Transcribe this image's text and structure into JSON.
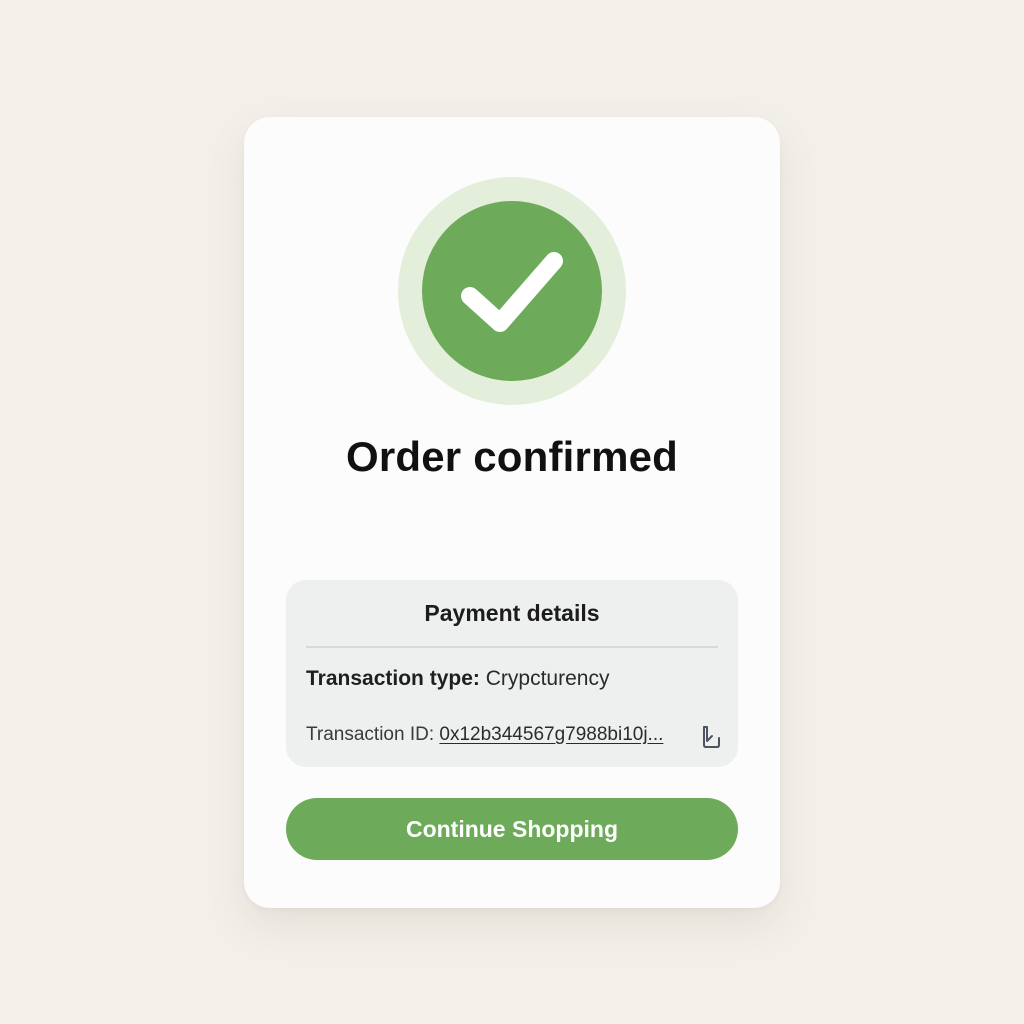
{
  "confirmation": {
    "icon": "checkmark-icon",
    "title": "Order confirmed"
  },
  "payment": {
    "heading": "Payment details",
    "type_label": "Transaction type:",
    "type_value": "Crypcturency",
    "id_label": "Transaction ID:",
    "id_value": "0x12b344567g7988bi10j...",
    "copy_icon": "copy-icon"
  },
  "actions": {
    "continue_label": "Continue Shopping"
  },
  "colors": {
    "accent": "#6daa5a",
    "accent_light": "#e3efdb",
    "page_background": "#f3f0ea",
    "card_background": "#fcfcfc",
    "panel_background": "#eef0f0"
  }
}
